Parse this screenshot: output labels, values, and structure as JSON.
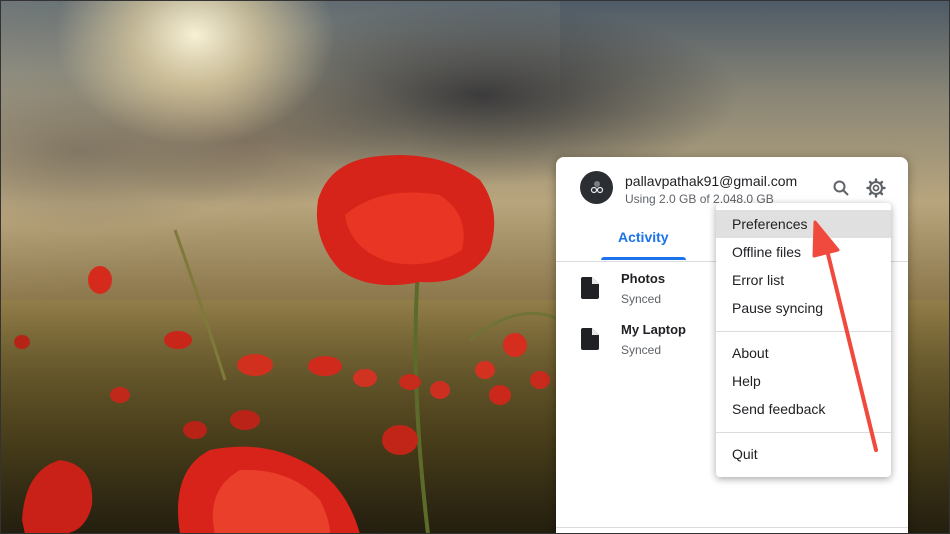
{
  "account": {
    "email": "pallavpathak91@gmail.com",
    "usage": "Using 2.0 GB of 2,048.0 GB"
  },
  "header_icons": {
    "search": "search-icon",
    "settings": "gear-icon"
  },
  "tabs": {
    "active": "Activity"
  },
  "activity": [
    {
      "name": "Photos",
      "status": "Synced"
    },
    {
      "name": "My Laptop",
      "status": "Synced"
    }
  ],
  "menu": {
    "group1": [
      "Preferences",
      "Offline files",
      "Error list",
      "Pause syncing"
    ],
    "group2": [
      "About",
      "Help",
      "Send feedback"
    ],
    "group3": [
      "Quit"
    ],
    "highlighted": "Preferences"
  },
  "colors": {
    "accent": "#1a73e8",
    "annotation_arrow": "#f04a3e",
    "menu_highlight": "#e0e0e0"
  }
}
